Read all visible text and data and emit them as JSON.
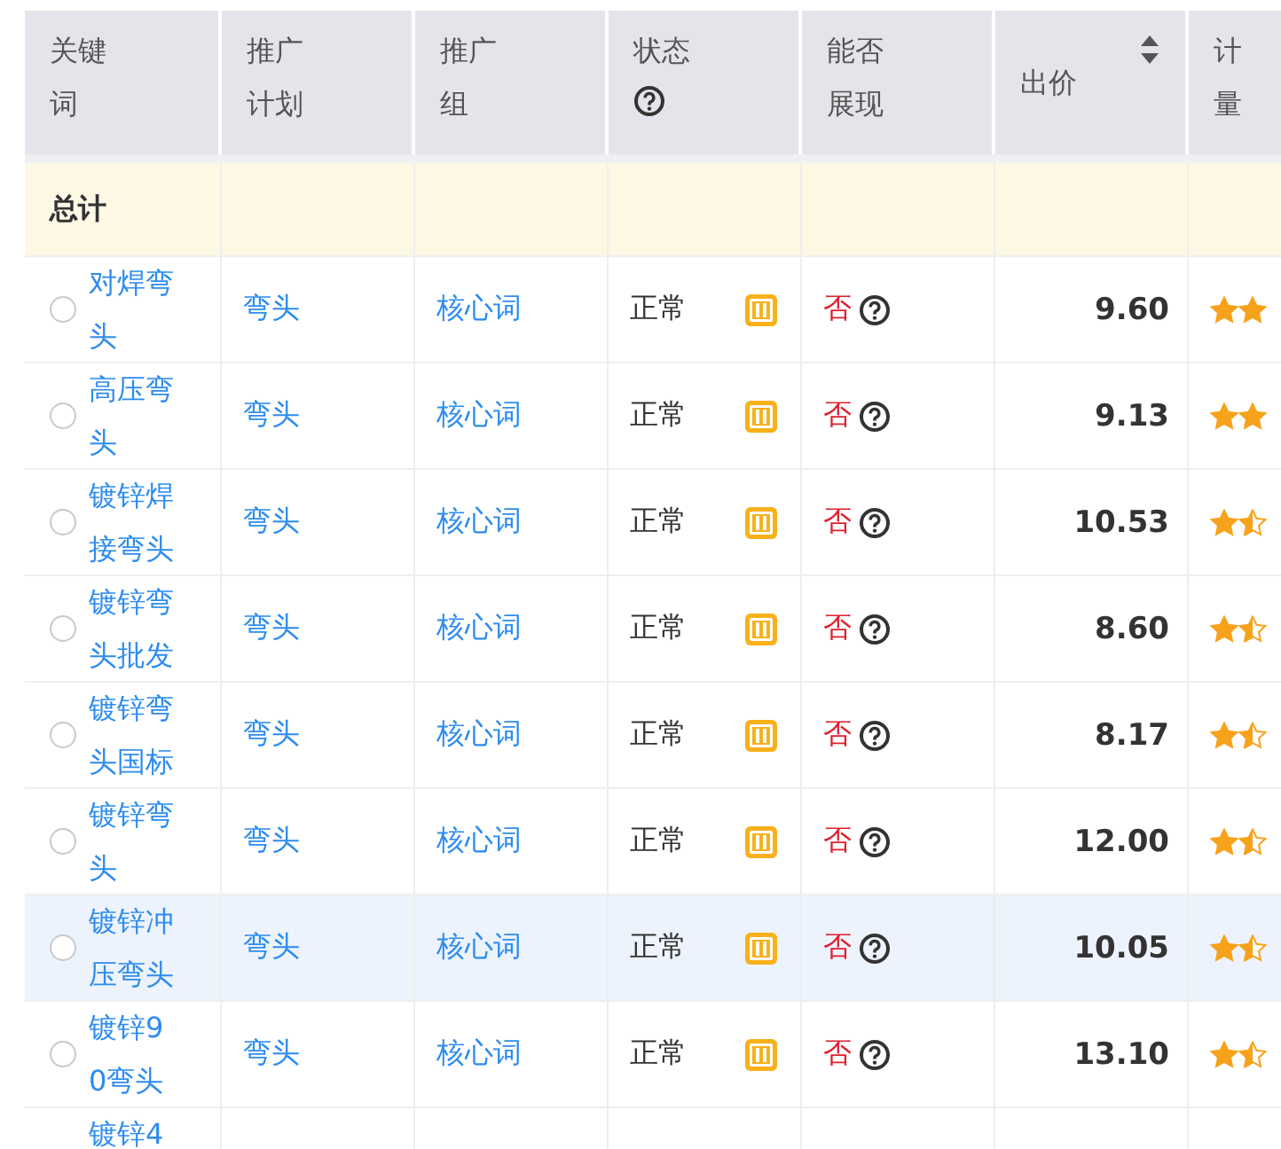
{
  "table": {
    "columns": [
      {
        "lines": [
          "关键",
          "词"
        ],
        "kind": "plain"
      },
      {
        "lines": [
          "推广",
          "计划"
        ],
        "kind": "plain"
      },
      {
        "lines": [
          "推广",
          "组"
        ],
        "kind": "plain"
      },
      {
        "lines": [
          "状态"
        ],
        "kind": "help"
      },
      {
        "lines": [
          "能否",
          "展现"
        ],
        "kind": "plain"
      },
      {
        "lines": [
          "出价"
        ],
        "kind": "sort"
      },
      {
        "lines": [
          "计",
          "量"
        ],
        "kind": "plain"
      }
    ],
    "total_row": {
      "label": "总计"
    },
    "rows": [
      {
        "keyword": "对焊弯头",
        "plan": "弯头",
        "group": "核心词",
        "status": "正常",
        "shown": "否",
        "bid": "9.60",
        "rating_icons": [
          {
            "kind": "full"
          },
          {
            "kind": "full"
          }
        ],
        "selected": false,
        "hovered": false
      },
      {
        "keyword": "高压弯头",
        "plan": "弯头",
        "group": "核心词",
        "status": "正常",
        "shown": "否",
        "bid": "9.13",
        "rating_icons": [
          {
            "kind": "full"
          },
          {
            "kind": "full"
          }
        ],
        "selected": false,
        "hovered": false
      },
      {
        "keyword": "镀锌焊接弯头",
        "plan": "弯头",
        "group": "核心词",
        "status": "正常",
        "shown": "否",
        "bid": "10.53",
        "rating_icons": [
          {
            "kind": "full"
          },
          {
            "kind": "half"
          }
        ],
        "selected": false,
        "hovered": false
      },
      {
        "keyword": "镀锌弯头批发",
        "plan": "弯头",
        "group": "核心词",
        "status": "正常",
        "shown": "否",
        "bid": "8.60",
        "rating_icons": [
          {
            "kind": "full"
          },
          {
            "kind": "half"
          }
        ],
        "selected": false,
        "hovered": false
      },
      {
        "keyword": "镀锌弯头国标",
        "plan": "弯头",
        "group": "核心词",
        "status": "正常",
        "shown": "否",
        "bid": "8.17",
        "rating_icons": [
          {
            "kind": "full"
          },
          {
            "kind": "half"
          }
        ],
        "selected": false,
        "hovered": false
      },
      {
        "keyword": "镀锌弯头",
        "plan": "弯头",
        "group": "核心词",
        "status": "正常",
        "shown": "否",
        "bid": "12.00",
        "rating_icons": [
          {
            "kind": "full"
          },
          {
            "kind": "half"
          }
        ],
        "selected": false,
        "hovered": false
      },
      {
        "keyword": "镀锌冲压弯头",
        "plan": "弯头",
        "group": "核心词",
        "status": "正常",
        "shown": "否",
        "bid": "10.05",
        "rating_icons": [
          {
            "kind": "full"
          },
          {
            "kind": "half"
          }
        ],
        "selected": false,
        "hovered": true
      },
      {
        "keyword": "镀锌90弯头",
        "plan": "弯头",
        "group": "核心词",
        "status": "正常",
        "shown": "否",
        "bid": "13.10",
        "rating_icons": [
          {
            "kind": "full"
          },
          {
            "kind": "half"
          }
        ],
        "selected": false,
        "hovered": false
      }
    ],
    "partial_row": {
      "keyword": "镀锌4"
    }
  }
}
